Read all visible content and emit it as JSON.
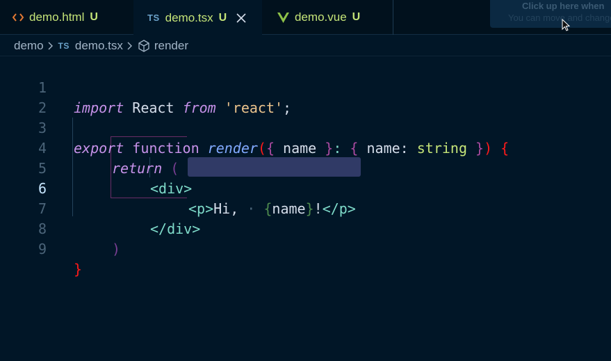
{
  "tabs": [
    {
      "name": "demo.html",
      "status": "U",
      "icon": "html-icon",
      "active": false
    },
    {
      "name": "demo.tsx",
      "status": "U",
      "icon": "ts-icon",
      "badge": "TS",
      "active": true
    },
    {
      "name": "demo.vue",
      "status": "U",
      "icon": "vue-icon",
      "active": false
    }
  ],
  "notification": {
    "title": "Click up here when",
    "subtitle": "You can move and change"
  },
  "breadcrumb": {
    "folder": "demo",
    "file_badge": "TS",
    "file": "demo.tsx",
    "symbol": "render"
  },
  "editor": {
    "active_line": 6,
    "lines": [
      {
        "number": "1"
      },
      {
        "number": "2"
      },
      {
        "number": "3"
      },
      {
        "number": "4"
      },
      {
        "number": "5"
      },
      {
        "number": "6"
      },
      {
        "number": "7"
      },
      {
        "number": "8"
      },
      {
        "number": "9"
      }
    ],
    "code": {
      "l1_import": "import",
      "l1_react": " React ",
      "l1_from": "from",
      "l1_str": " 'react'",
      "l1_semi": ";",
      "l3_export": "export",
      "l3_function": " function ",
      "l3_render": "render",
      "l3_paren_open": "(",
      "l3_brace_open": "{",
      "l3_name": " name ",
      "l3_brace_close": "}",
      "l3_colon": ": ",
      "l3_type_open": "{",
      "l3_name2": " name: ",
      "l3_string": "string",
      "l3_type_close": " }",
      "l3_paren_close": ")",
      "l3_body_open": " {",
      "l4_return": "return",
      "l4_paren": " (",
      "l5_div_open": "<div>",
      "l6_p_open": "<p>",
      "l6_hi": "Hi,",
      "l6_dot": " · ",
      "l6_expr_open": "{",
      "l6_name": "name",
      "l6_expr_close": "}",
      "l6_bang": "!",
      "l6_p_close": "</p>",
      "l7_div_close": "</div>",
      "l8_paren": ")",
      "l9_brace": "}"
    }
  },
  "colors": {
    "background": "#011627",
    "keyword": "#c792ea",
    "function": "#82aaff",
    "string": "#ecc48d",
    "tag": "#7fdbca",
    "type": "#c5e478",
    "bracket_red": "#ff1a1a"
  }
}
